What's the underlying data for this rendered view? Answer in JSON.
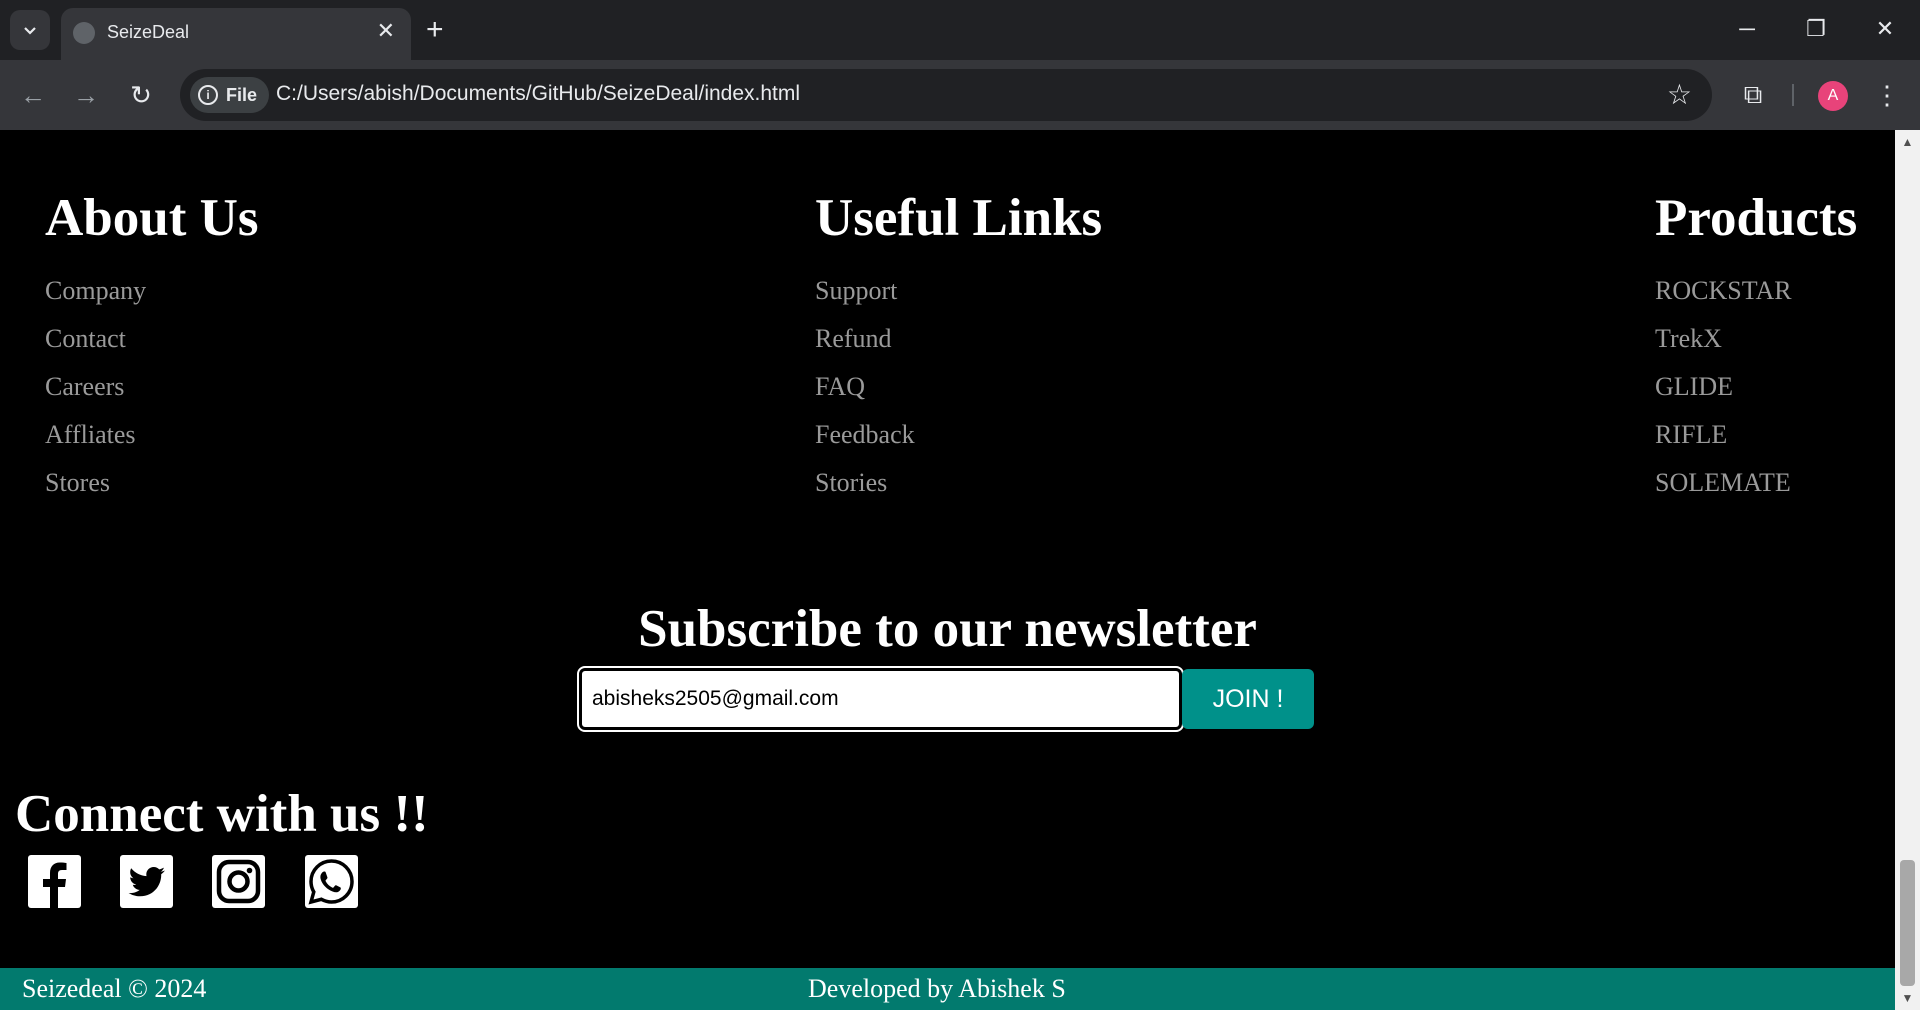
{
  "browser": {
    "tab_title": "SeizeDeal",
    "new_tab_symbol": "+",
    "url_scheme_label": "File",
    "url": "C:/Users/abish/Documents/GitHub/SeizeDeal/index.html",
    "profile_initial": "A"
  },
  "footer_columns": {
    "about": {
      "title": "About Us",
      "links": [
        "Company",
        "Contact",
        "Careers",
        "Affliates",
        "Stores"
      ]
    },
    "useful": {
      "title": "Useful Links",
      "links": [
        "Support",
        "Refund",
        "FAQ",
        "Feedback",
        "Stories"
      ]
    },
    "products": {
      "title": "Products",
      "links": [
        "ROCKSTAR",
        "TrekX",
        "GLIDE",
        "RIFLE",
        "SOLEMATE"
      ]
    }
  },
  "newsletter": {
    "title": "Subscribe to our newsletter",
    "email_value": "abisheks2505@gmail.com",
    "join_label": "JOIN !"
  },
  "connect": {
    "title": "Connect with us !!",
    "icons": [
      "facebook-icon",
      "twitter-icon",
      "instagram-icon",
      "whatsapp-icon"
    ]
  },
  "bottom_bar": {
    "copyright": "Seizedeal © 2024",
    "credit": "Developed by Abishek S"
  },
  "colors": {
    "accent": "#00918a",
    "footer_bar": "#027a6e",
    "link_gray": "#9a9a9a",
    "avatar": "#e8437a"
  }
}
